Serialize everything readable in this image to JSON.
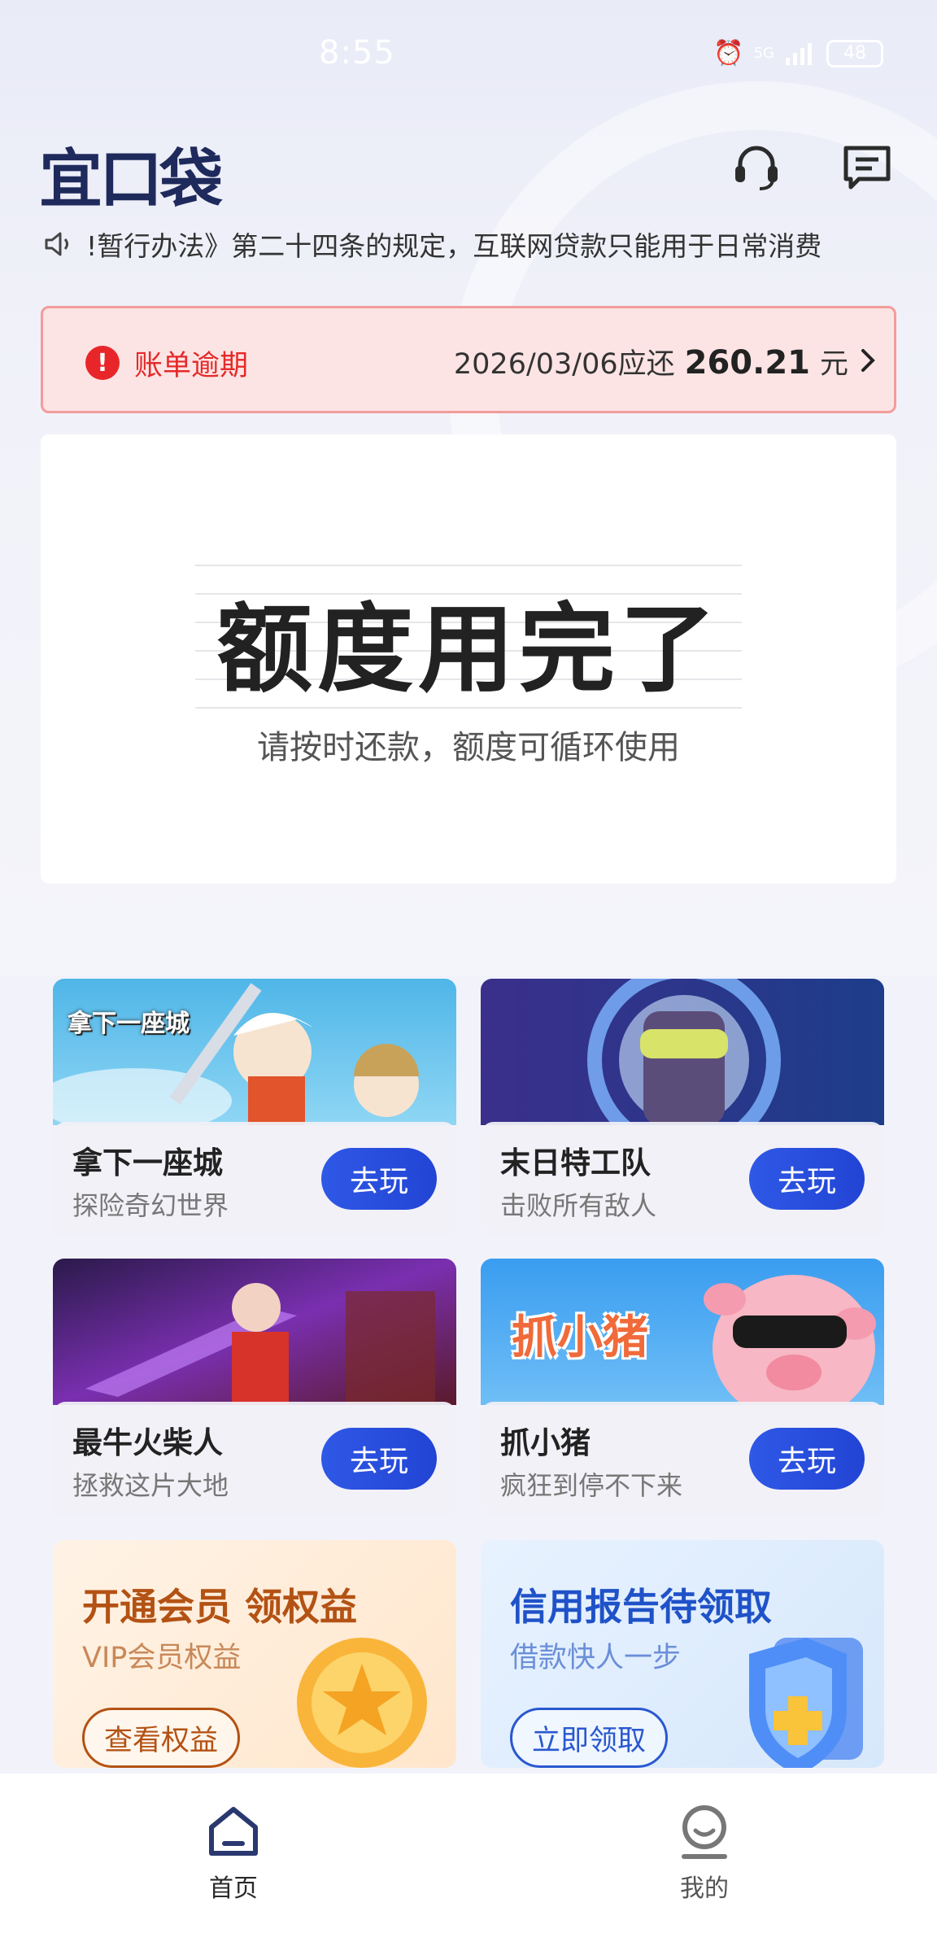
{
  "status_bar": {
    "time": "8:55",
    "network": "5G",
    "battery": "48"
  },
  "header": {
    "logo": "宜口袋"
  },
  "notice": {
    "text": "!暂行办法》第二十四条的规定，互联网贷款只能用于日常消费"
  },
  "overdue": {
    "title": "账单逾期",
    "due_text": "2026/03/06应还",
    "amount": "260.21",
    "unit": "元"
  },
  "quota": {
    "title": "额度用完了",
    "subtitle": "请按时还款，额度可循环使用"
  },
  "games": [
    {
      "name": "拿下一座城",
      "desc": "探险奇幻世界",
      "button": "去玩",
      "art_text": "拿下一座城"
    },
    {
      "name": "末日特工队",
      "desc": "击败所有敌人",
      "button": "去玩"
    },
    {
      "name": "最牛火柴人",
      "desc": "拯救这片大地",
      "button": "去玩"
    },
    {
      "name": "抓小猪",
      "desc": "疯狂到停不下来",
      "button": "去玩",
      "art_text": "抓小猪"
    }
  ],
  "promos": [
    {
      "title": "开通会员 领权益",
      "subtitle": "VIP会员权益",
      "button": "查看权益"
    },
    {
      "title": "信用报告待领取",
      "subtitle": "借款快人一步",
      "button": "立即领取"
    }
  ],
  "bottom_nav": [
    {
      "label": "首页",
      "active": true
    },
    {
      "label": "我的",
      "active": false
    }
  ],
  "colors": {
    "accent_blue": "#2a4fe0",
    "alert_red": "#e52a2a",
    "nav_active": "#2a3870",
    "nav_inactive": "#777777"
  }
}
